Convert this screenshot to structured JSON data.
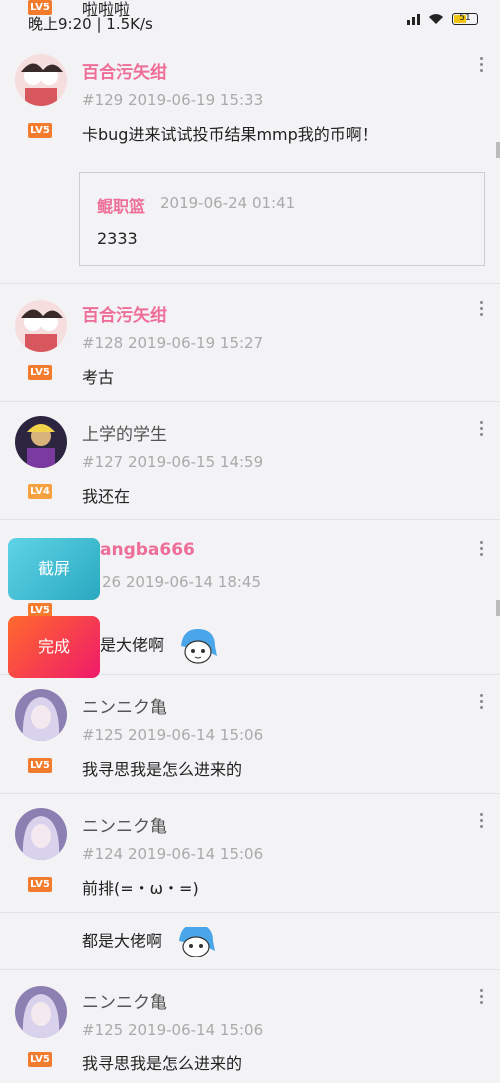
{
  "status_bar": {
    "time": "晚上9:20 | 1.5K/s",
    "battery": "51"
  },
  "prev_post": {
    "level": "LV5",
    "text": "啦啦啦"
  },
  "posts": [
    {
      "name": "百合污矢绀",
      "level": "LV5",
      "meta": "#129   2019-06-19 15:33",
      "content": "卡bug进来试试投币结果mmp我的币啊！",
      "quote": {
        "name": "鲲职篮",
        "time": "2019-06-24 01:41",
        "text": "2333"
      }
    },
    {
      "name": "百合污矢绀",
      "level": "LV5",
      "meta": "#128   2019-06-19 15:27",
      "content": "考古"
    },
    {
      "name": "上学的学生",
      "level": "LV4",
      "meta": "#127   2019-06-15 14:59",
      "content": "我还在"
    },
    {
      "name": "angba666",
      "level": "LV5",
      "meta": "26   2019-06-14 18:45",
      "content": "是大佬啊"
    },
    {
      "name": "ニンニク亀",
      "level": "LV5",
      "meta": "#125   2019-06-14 15:06",
      "content": "我寻思我是怎么进来的"
    },
    {
      "name": "ニンニク亀",
      "level": "LV5",
      "meta": "#124   2019-06-14 15:06",
      "content": "前排(=・ω・=)"
    },
    {
      "content": "都是大佬啊"
    },
    {
      "name": "ニンニク亀",
      "level": "LV5",
      "meta": "#125   2019-06-14 15:06",
      "content": "我寻思我是怎么进来的"
    }
  ],
  "floating_buttons": {
    "screenshot": "截屏",
    "done": "完成"
  },
  "icons": [
    "signal-icon",
    "wifi-icon",
    "battery-icon",
    "more-icon",
    "sticker-icon"
  ],
  "colors": {
    "pink_name": "#ee6e99",
    "level_badge": "#f27b2e",
    "screenshot_btn": "#29a9c0",
    "done_btn": "#ef1a6b"
  }
}
